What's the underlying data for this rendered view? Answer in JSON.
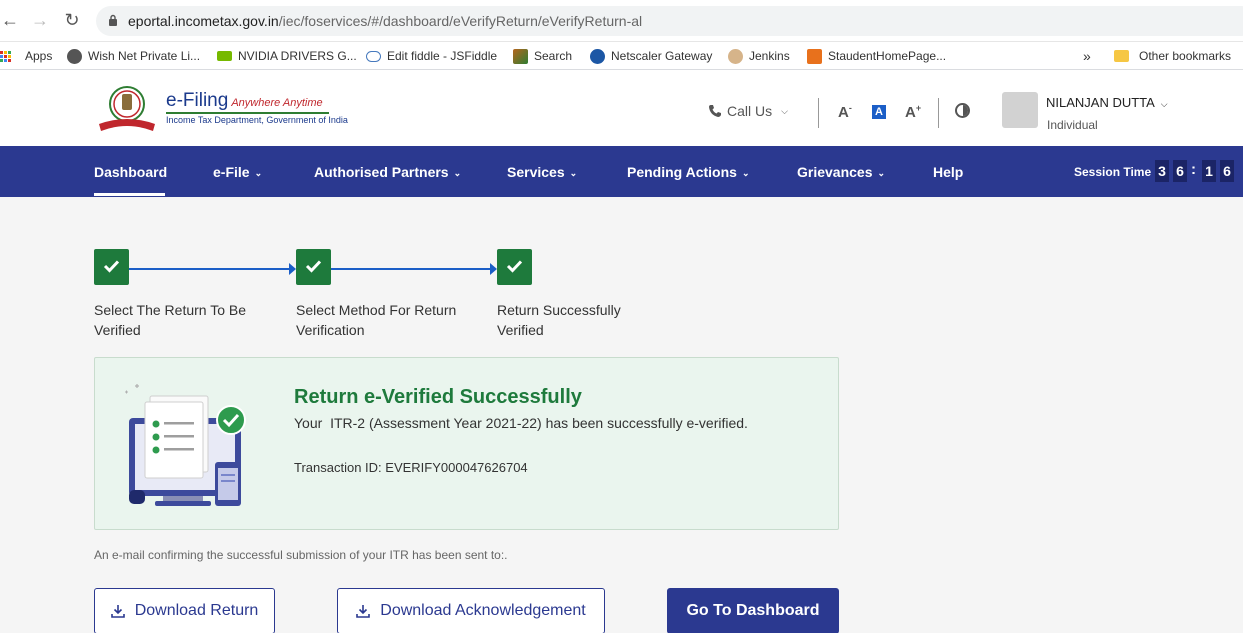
{
  "browser": {
    "url_host": "eportal.incometax.gov.in",
    "url_path": "/iec/foservices/#/dashboard/eVerifyReturn/eVerifyReturn-al",
    "bookmarks": [
      {
        "label": "Apps",
        "icon": "apps-grid-icon"
      },
      {
        "label": "Wish Net Private Li...",
        "icon": "globe-icon"
      },
      {
        "label": "NVIDIA DRIVERS G...",
        "icon": "nvidia-icon"
      },
      {
        "label": "Edit fiddle - JSFiddle",
        "icon": "jsfiddle-icon"
      },
      {
        "label": "Search",
        "icon": "search-site-icon"
      },
      {
        "label": "Netscaler Gateway",
        "icon": "tata-icon"
      },
      {
        "label": "Jenkins",
        "icon": "jenkins-icon"
      },
      {
        "label": "StaudentHomePage...",
        "icon": "bookmark-site-icon"
      }
    ],
    "more_bookmarks": "»",
    "other_bookmarks": "Other bookmarks"
  },
  "header": {
    "logo_title": "e-Filing",
    "logo_tagline": "Anywhere Anytime",
    "logo_subtitle": "Income Tax Department, Government of India",
    "call_us": "Call Us",
    "font_decrease": "A",
    "font_normal": "A",
    "font_increase": "A",
    "user_name": "NILANJAN DUTTA",
    "user_role": "Individual"
  },
  "nav": {
    "items": [
      {
        "label": "Dashboard",
        "dropdown": false
      },
      {
        "label": "e-File",
        "dropdown": true
      },
      {
        "label": "Authorised Partners",
        "dropdown": true
      },
      {
        "label": "Services",
        "dropdown": true
      },
      {
        "label": "Pending Actions",
        "dropdown": true
      },
      {
        "label": "Grievances",
        "dropdown": true
      },
      {
        "label": "Help",
        "dropdown": false
      }
    ],
    "session_label": "Session Time",
    "session_digits": [
      "3",
      "6",
      "1",
      "6"
    ]
  },
  "steps": [
    {
      "label": "Select The Return To Be Verified",
      "status": "complete"
    },
    {
      "label": "Select Method For Return Verification",
      "status": "complete"
    },
    {
      "label": "Return Successfully Verified",
      "status": "complete"
    }
  ],
  "success": {
    "title": "Return e-Verified Successfully",
    "message": "Your  ITR-2 (Assessment Year 2021-22) has been successfully e-verified.",
    "transaction": "Transaction ID: EVERIFY000047626704"
  },
  "email_note": "An e-mail confirming the successful submission of your ITR has been sent to:.",
  "actions": {
    "download_return": "Download Return",
    "download_ack": "Download Acknowledgement",
    "go_dashboard": "Go To Dashboard"
  },
  "colors": {
    "nav_bg": "#2b3990",
    "success_green": "#1e7a3c",
    "success_card_bg": "#eaf5ee"
  }
}
